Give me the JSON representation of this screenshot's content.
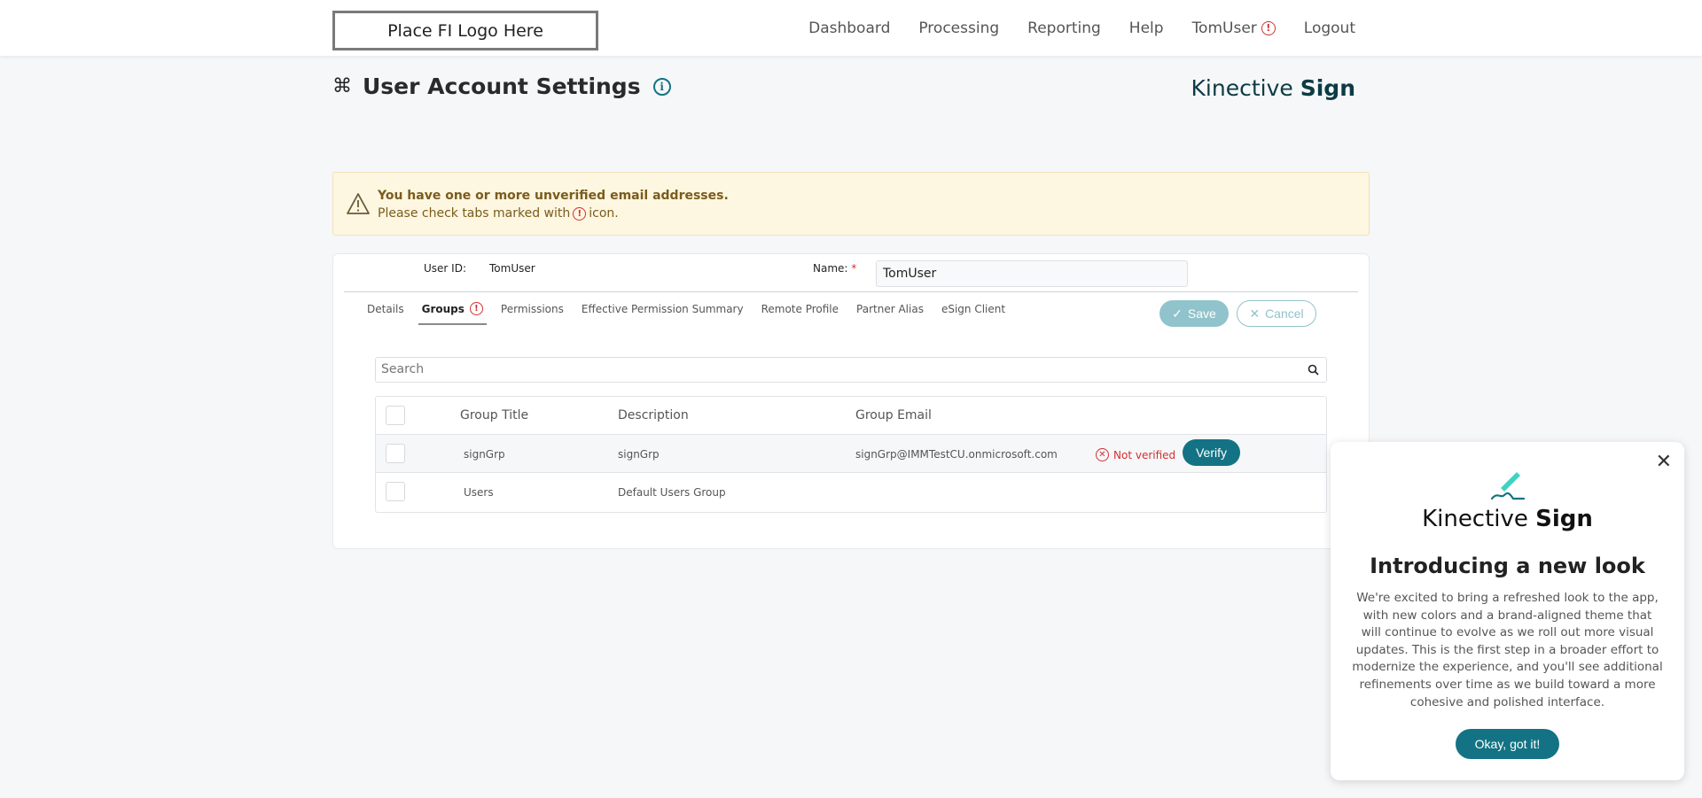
{
  "header": {
    "logo_text": "Place FI Logo Here",
    "nav": [
      "Dashboard",
      "Processing",
      "Reporting",
      "Help",
      "TomUser",
      "Logout"
    ]
  },
  "page": {
    "title": "User Account Settings",
    "brand_light": "Kinective",
    "brand_bold": "Sign"
  },
  "alert": {
    "title": "You have one or more unverified email addresses.",
    "prefix": "Please check tabs marked with",
    "suffix": "icon."
  },
  "form": {
    "user_id_label": "User ID:",
    "user_id_value": "TomUser",
    "name_label": "Name:",
    "name_required": "*",
    "name_value": "TomUser"
  },
  "tabs": [
    "Details",
    "Groups",
    "Permissions",
    "Effective Permission Summary",
    "Remote Profile",
    "Partner Alias",
    "eSign Client"
  ],
  "actions": {
    "save": "Save",
    "cancel": "Cancel"
  },
  "search": {
    "placeholder": "Search"
  },
  "table": {
    "headers": [
      "Group Title",
      "Description",
      "Group Email"
    ],
    "rows": [
      {
        "title": "signGrp",
        "description": "signGrp",
        "email": "signGrp@IMMTestCU.onmicrosoft.com",
        "status": "Not verified",
        "action": "Verify"
      },
      {
        "title": "Users",
        "description": "Default Users Group",
        "email": "",
        "status": "",
        "action": ""
      }
    ]
  },
  "popup": {
    "brand_light": "Kinective",
    "brand_bold": "Sign",
    "title": "Introducing a new look",
    "body": "We're excited to bring a refreshed look to the app, with new colors and a brand-aligned theme that will continue to evolve as we roll out more visual updates. This is the first step in a broader effort to modernize the experience, and you'll see additional refinements over time as we build toward a more cohesive and polished interface.",
    "button": "Okay, got it!"
  },
  "colors": {
    "accent": "#137384",
    "warning": "#d32f2f",
    "alert_bg": "#fdf6e1"
  }
}
